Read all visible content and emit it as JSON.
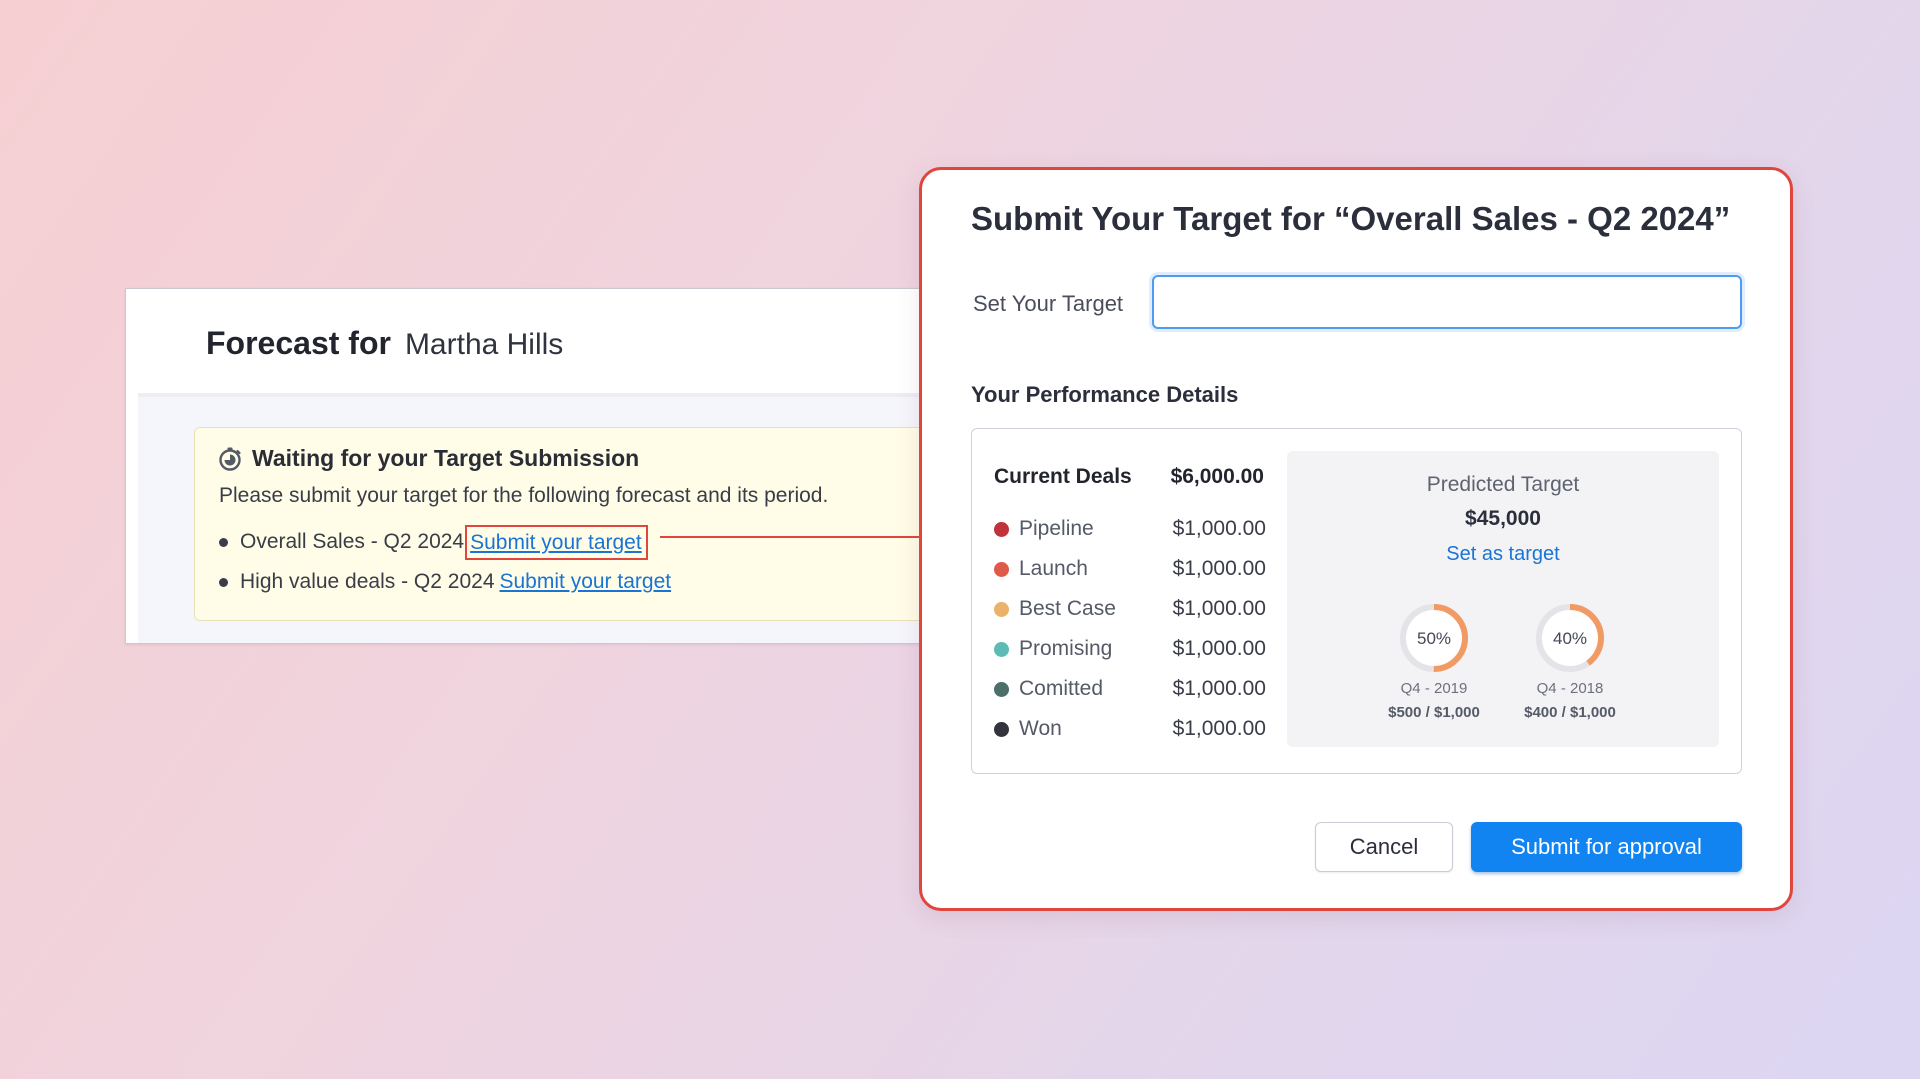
{
  "forecast": {
    "title_label": "Forecast for",
    "person_name": "Martha Hills",
    "notice": {
      "heading": "Waiting for your Target Submission",
      "description": "Please submit your target for the following forecast and its period.",
      "items": [
        {
          "text": "Overall Sales - Q2 2024",
          "link": "Submit your target"
        },
        {
          "text": "High value deals - Q2 2024",
          "link": "Submit your target"
        }
      ]
    }
  },
  "dialog": {
    "title": "Submit Your Target for “Overall Sales - Q2 2024”",
    "target_label": "Set Your Target",
    "target_value": "",
    "performance_title": "Your Performance Details",
    "current_deals_label": "Current Deals",
    "current_deals_total": "$6,000.00",
    "deals": [
      {
        "name": "Pipeline",
        "value": "$1,000.00",
        "color": "#c1333b"
      },
      {
        "name": "Launch",
        "value": "$1,000.00",
        "color": "#e05a4a"
      },
      {
        "name": "Best Case",
        "value": "$1,000.00",
        "color": "#eab26b"
      },
      {
        "name": "Promising",
        "value": "$1,000.00",
        "color": "#5cbcb4"
      },
      {
        "name": "Comitted",
        "value": "$1,000.00",
        "color": "#4d6f6a"
      },
      {
        "name": "Won",
        "value": "$1,000.00",
        "color": "#33353d"
      }
    ],
    "predicted": {
      "label": "Predicted Target",
      "value": "$45,000",
      "set_link": "Set as target",
      "gauges": [
        {
          "percent_label": "50%",
          "percent": 50,
          "period": "Q4 - 2019",
          "amount": "$500 / $1,000"
        },
        {
          "percent_label": "40%",
          "percent": 40,
          "period": "Q4 - 2018",
          "amount": "$400 / $1,000"
        }
      ]
    },
    "buttons": {
      "cancel": "Cancel",
      "submit": "Submit for approval"
    },
    "colors": {
      "accent": "#1284f2",
      "highlight": "#e0463d",
      "gauge": "#f29a63"
    }
  }
}
